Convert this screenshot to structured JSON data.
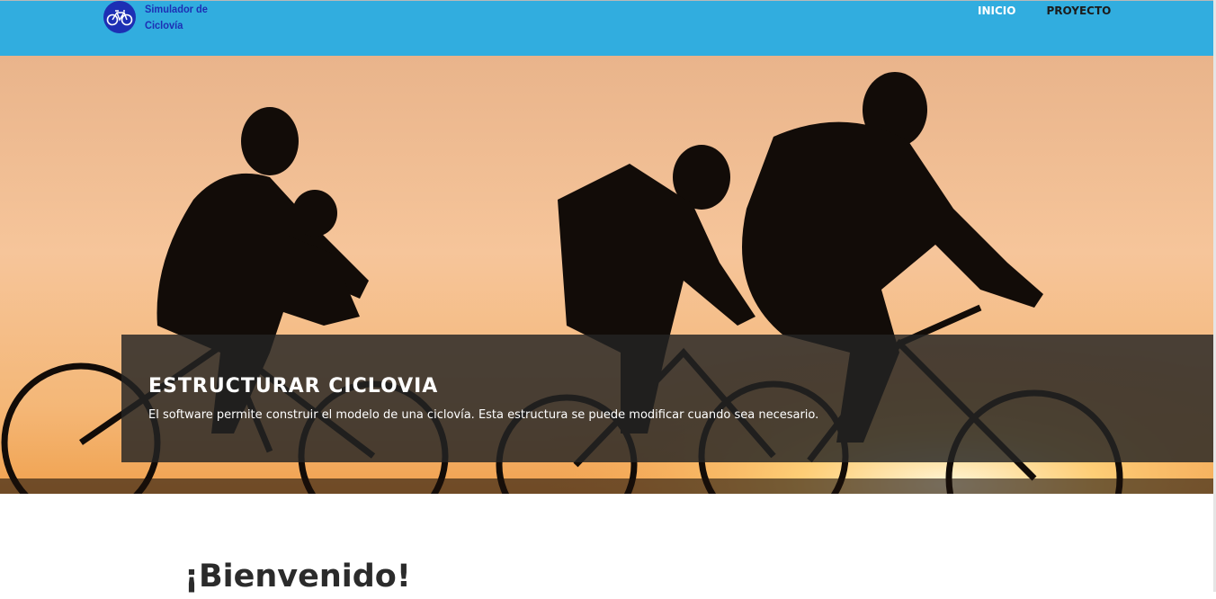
{
  "brand": {
    "name": "Simulador de Ciclovía",
    "icon": "bicycle-icon",
    "logo_color": "#1d2fb4"
  },
  "nav": {
    "background": "#31addf",
    "items": [
      {
        "label": "INICIO",
        "active": true
      },
      {
        "label": "PROYECTO",
        "active": false
      }
    ]
  },
  "hero": {
    "image": "cyclists-silhouette-sunset",
    "title": "ESTRUCTURAR CICLOVIA",
    "text": "El software permite construir el modelo de una ciclovía. Esta estructura se puede modificar cuando sea necesario."
  },
  "main": {
    "heading": "¡Bienvenido!"
  }
}
